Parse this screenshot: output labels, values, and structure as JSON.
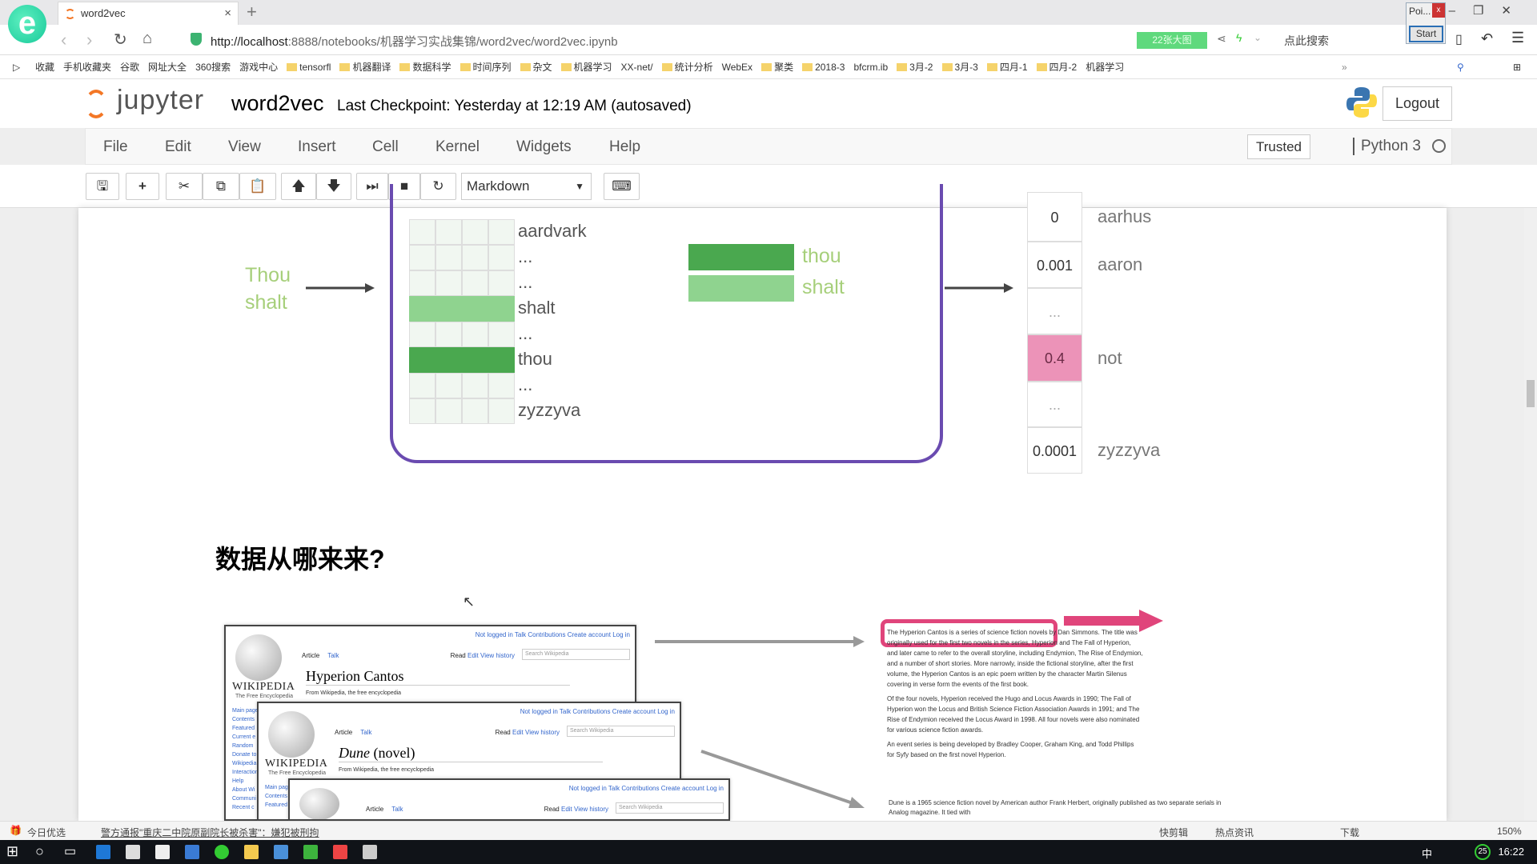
{
  "browser": {
    "tab_title": "word2vec",
    "url_host": "http://localhost",
    "url_rest": ":8888/notebooks/机器学习实战集锦/word2vec/word2vec.ipynb",
    "big_image_button": "22张大图",
    "search_hint": "点此搜索",
    "popup": {
      "title": "Poi...",
      "close": "x",
      "start": "Start"
    },
    "bookmarks": [
      "收藏",
      "手机收藏夹",
      "谷歌",
      "网址大全",
      "360搜索",
      "游戏中心",
      "tensorfl",
      "机器翻译",
      "数据科学",
      "时间序列",
      "杂文",
      "机器学习",
      "XX-net/",
      "统计分析",
      "WebEx",
      "聚类",
      "2018-3",
      "bfcrm.ib",
      "3月-2",
      "3月-3",
      "四月-1",
      "四月-2",
      "机器学习"
    ],
    "bookmark_folders": [
      false,
      false,
      false,
      false,
      false,
      false,
      true,
      true,
      true,
      true,
      true,
      true,
      false,
      true,
      false,
      true,
      true,
      false,
      true,
      true,
      true,
      true,
      false
    ]
  },
  "jupyter": {
    "logo_text": "jupyter",
    "notebook_name": "word2vec",
    "checkpoint": "Last Checkpoint: Yesterday at 12:19 AM (autosaved)",
    "logout": "Logout",
    "menu": [
      "File",
      "Edit",
      "View",
      "Insert",
      "Cell",
      "Kernel",
      "Widgets",
      "Help"
    ],
    "trusted": "Trusted",
    "kernel": "Python 3",
    "cell_type": "Markdown",
    "toolbar_icons": [
      "save-icon",
      "plus-icon",
      "scissors-icon",
      "copy-icon",
      "paste-icon",
      "arrow-up-icon",
      "arrow-down-icon",
      "step-forward-icon",
      "stop-icon",
      "restart-icon",
      "keyboard-icon"
    ]
  },
  "figure": {
    "input_words": [
      "Thou",
      "shalt"
    ],
    "embedding_rows": [
      "aardvark",
      "...",
      "...",
      "shalt",
      "...",
      "thou",
      "...",
      "zyzzyva"
    ],
    "embedding_highlight": {
      "shalt": "#8fd38f",
      "thou": "#4aa84f"
    },
    "lookup": [
      {
        "word": "thou",
        "color": "#4aa84f"
      },
      {
        "word": "shalt",
        "color": "#8fd38f"
      }
    ],
    "outputs": [
      {
        "value": "0",
        "word": "aarhus"
      },
      {
        "value": "0.001",
        "word": "aaron"
      },
      {
        "value": "...",
        "word": ""
      },
      {
        "value": "0.4",
        "word": "not"
      },
      {
        "value": "...",
        "word": ""
      },
      {
        "value": "0.0001",
        "word": "zyzzyva"
      }
    ],
    "output_highlight_color": "#ec93b8",
    "box_color": "#6a4bb0"
  },
  "section": {
    "heading": "数据从哪来来?",
    "wiki_pages": [
      {
        "title": "Hyperion Cantos",
        "italic": false
      },
      {
        "title": "Dune",
        "title_suffix": " (novel)",
        "italic": true
      },
      {
        "title": "",
        "italic": false
      }
    ],
    "wiki": {
      "wordmark": "WIKIPEDIA",
      "slogan": "The Free Encyclopedia",
      "top_links": "Not logged in  Talk  Contributions  Create account  Log in",
      "tab_article": "Article",
      "tab_talk": "Talk",
      "tab_read": "Read",
      "tab_edit": "Edit",
      "tab_history": "View history",
      "search": "Search Wikipedia",
      "from": "From Wikipedia, the free encyclopedia",
      "side": [
        "Main page",
        "Contents",
        "Featured",
        "Current e",
        "Random",
        "Donate to",
        "Wikipedia",
        "Interaction",
        "Help",
        "About Wi",
        "Communi",
        "Recent c"
      ]
    },
    "excerpt": [
      "The Hyperion Cantos is a series of science fiction novels by Dan Simmons. The title was originally used for the first two novels in the series, Hyperion and The Fall of Hyperion, and later came to refer to the overall storyline, including Endymion, The Rise of Endymion, and a number of short stories. More narrowly, inside the fictional storyline, after the first volume, the Hyperion Cantos is an epic poem written by the character Martin Silenus covering in verse form the events of the first book.",
      "Of the four novels, Hyperion received the Hugo and Locus Awards in 1990; The Fall of Hyperion won the Locus and British Science Fiction Association Awards in 1991; and The Rise of Endymion received the Locus Award in 1998. All four novels were also nominated for various science fiction awards.",
      "An event series is being developed by Bradley Cooper, Graham King, and Todd Phillips for Syfy based on the first novel Hyperion."
    ],
    "dune_excerpt": "Dune is a 1965 science fiction novel by American author Frank Herbert, originally published as two separate serials in Analog magazine. It tied with",
    "highlight_color": "#e0457b"
  },
  "statusbar": {
    "left": "今日优选",
    "news": "警方通报\"重庆二中院原副院长被杀害\"：嫌犯被刑拘",
    "items": [
      "快剪辑",
      "热点资讯",
      "下载"
    ],
    "zoom": "150%"
  },
  "taskbar": {
    "time": "16:22",
    "ime": "中",
    "badge": "25"
  }
}
